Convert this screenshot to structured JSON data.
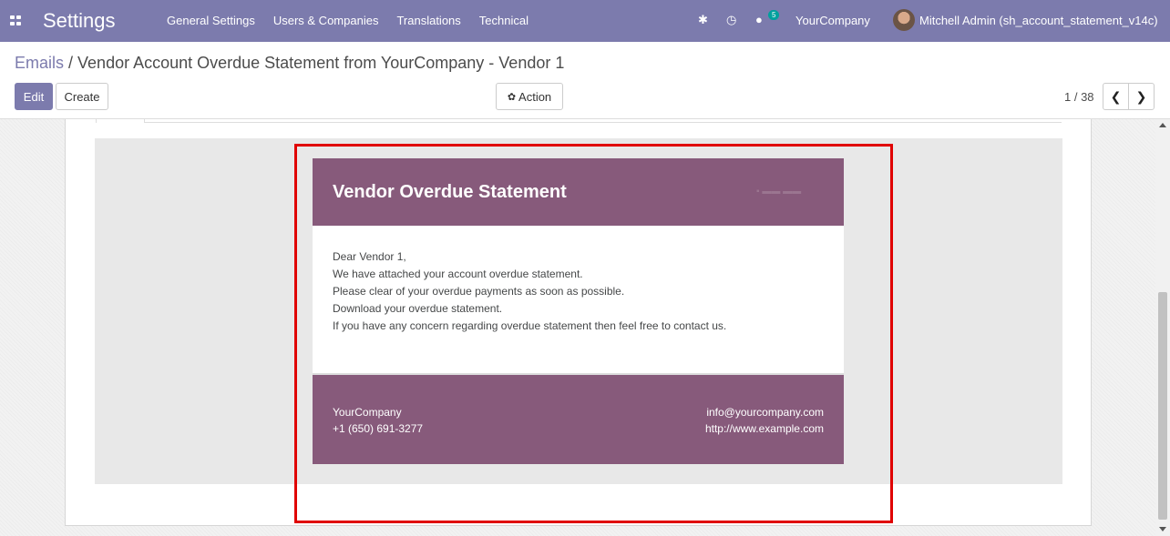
{
  "navbar": {
    "app_title": "Settings",
    "menu": [
      "General Settings",
      "Users & Companies",
      "Translations",
      "Technical"
    ],
    "chat_badge": "5",
    "company": "YourCompany",
    "user": "Mitchell Admin (sh_account_statement_v14c)"
  },
  "breadcrumb": {
    "parent": "Emails",
    "separator": " / ",
    "current": "Vendor Account Overdue Statement from YourCompany - Vendor 1"
  },
  "buttons": {
    "edit": "Edit",
    "create": "Create",
    "action": "Action"
  },
  "pager": {
    "value": "1 / 38"
  },
  "email": {
    "title": "Vendor Overdue Statement",
    "body_lines": [
      "Dear Vendor 1,",
      "We have attached your account overdue statement.",
      "Please clear of your overdue payments as soon as possible.",
      "Download your overdue statement.",
      "If you have any concern regarding overdue statement then feel free to contact us."
    ],
    "footer": {
      "company": "YourCompany",
      "phone": "+1 (650) 691-3277",
      "email": "info@yourcompany.com",
      "website": "http://www.example.com"
    }
  },
  "colors": {
    "navbar": "#7c7bad",
    "email_header": "#875a7b",
    "highlight": "#e00000"
  }
}
